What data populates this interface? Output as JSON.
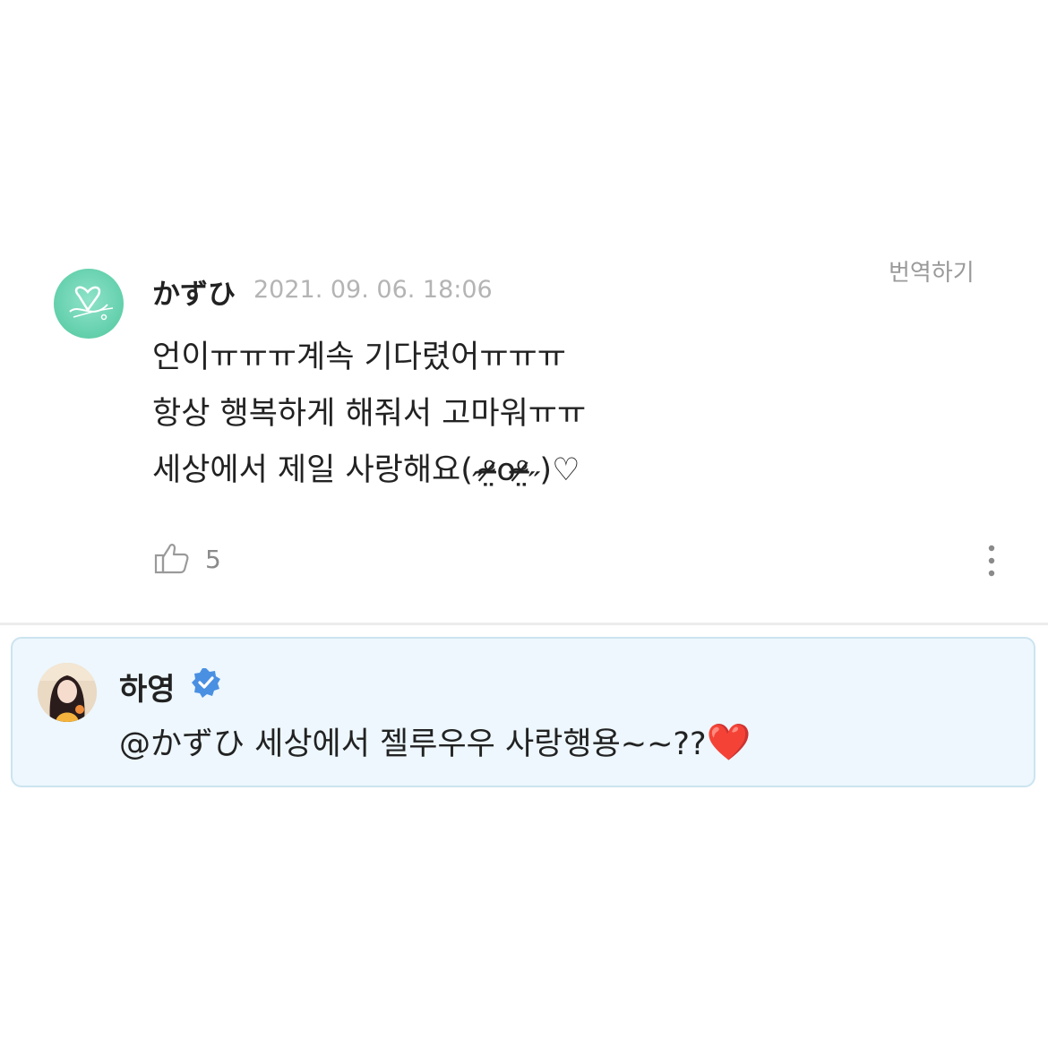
{
  "comment": {
    "username": "かずひ",
    "timestamp": "2021. 09. 06. 18:06",
    "translate_label": "번역하기",
    "lines": [
      "언이ㅠㅠㅠ계속 기다렸어ㅠㅠㅠ",
      "항상 행복하게 해줘서 고마워ㅠㅠ",
      "세상에서 제일 사랑해요(˶ᵒ̴̶̷̤໐ᵒ̴̶̷̤˶)♡"
    ],
    "like_count": "5"
  },
  "reply": {
    "author": "하영",
    "text": "@かずひ 세상에서 젤루우우 사랑행용~~??",
    "emoji": "❤️"
  },
  "colors": {
    "reply_background": "#edf7fd",
    "reply_border": "#cce4f0",
    "verified_badge": "#4a90e2",
    "fan_avatar": "#62cfab"
  }
}
